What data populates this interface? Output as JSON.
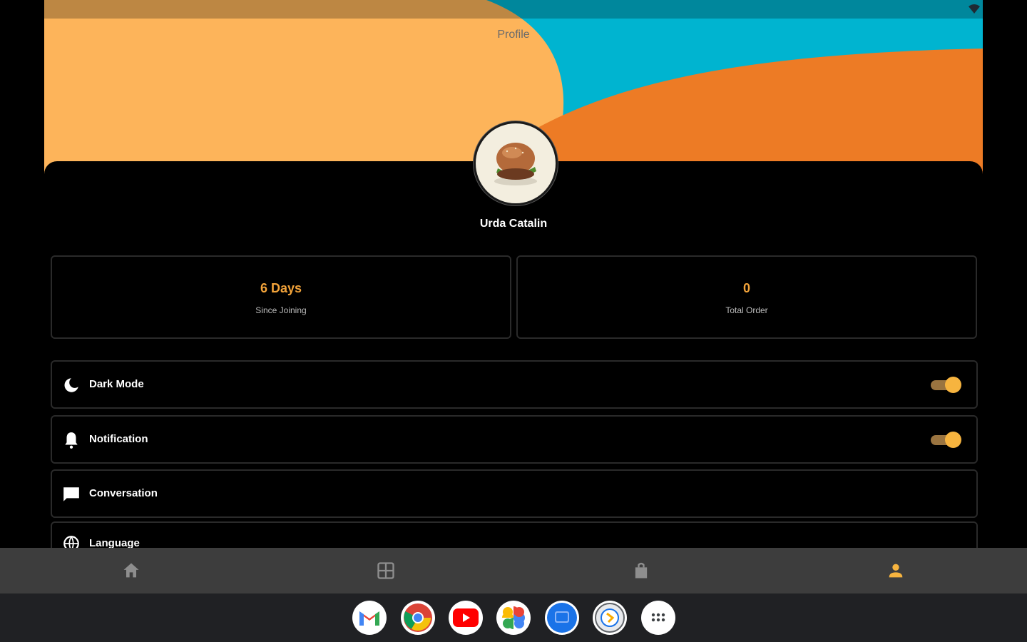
{
  "header": {
    "title": "Profile"
  },
  "user": {
    "name": "Urda Catalin"
  },
  "stats": [
    {
      "value": "6 Days",
      "label": "Since Joining"
    },
    {
      "value": "0",
      "label": "Total Order"
    }
  ],
  "settings": [
    {
      "label": "Dark Mode",
      "icon": "moon-icon",
      "toggle": true,
      "on": true
    },
    {
      "label": "Notification",
      "icon": "bell-icon",
      "toggle": true,
      "on": true
    },
    {
      "label": "Conversation",
      "icon": "chat-icon",
      "toggle": false
    },
    {
      "label": "Language",
      "icon": "language-icon",
      "toggle": false
    }
  ],
  "bottom_nav": [
    {
      "name": "home-icon",
      "active": false
    },
    {
      "name": "menu-grid-icon",
      "active": false
    },
    {
      "name": "shopping-bag-icon",
      "active": false
    },
    {
      "name": "profile-icon",
      "active": true
    }
  ],
  "dock": [
    "gmail-icon",
    "chrome-icon",
    "youtube-icon",
    "photos-icon",
    "messages-icon",
    "app-icon",
    "app-launcher-icon"
  ],
  "colors": {
    "accent": "#f7b43f",
    "header_orange": "#fdb45a",
    "header_teal": "#00b4d0",
    "header_dark_orange": "#ed7b25",
    "nav_bg": "#3d3d3d"
  }
}
